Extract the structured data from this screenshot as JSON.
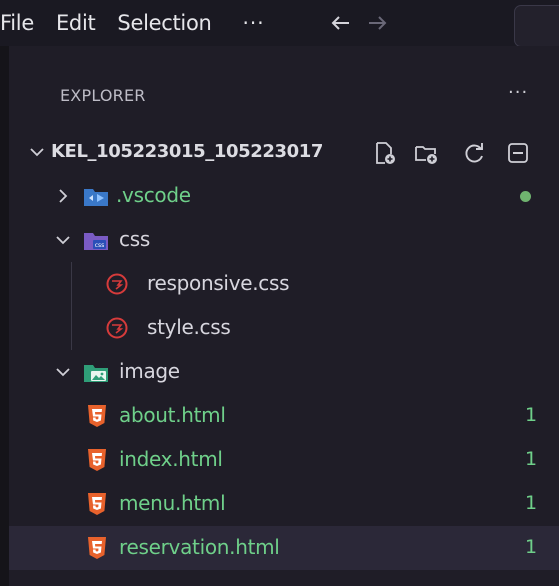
{
  "menubar": {
    "file": "File",
    "edit": "Edit",
    "selection": "Selection",
    "more": "···",
    "back_icon": "arrow-left-icon",
    "forward_icon": "arrow-right-icon"
  },
  "explorer": {
    "title": "EXPLORER",
    "more": "···",
    "root": {
      "label": "KEL_105223015_105223017",
      "actions": [
        "new-file-icon",
        "new-folder-icon",
        "refresh-icon",
        "collapse-all-icon"
      ]
    },
    "items": [
      {
        "label": ".vscode",
        "type": "folder",
        "expanded": false,
        "status": "dot",
        "color": "#6fd08a"
      },
      {
        "label": "css",
        "type": "folder",
        "expanded": true
      },
      {
        "label": "responsive.css",
        "type": "file"
      },
      {
        "label": "style.css",
        "type": "file"
      },
      {
        "label": "image",
        "type": "folder",
        "expanded": true
      },
      {
        "label": "about.html",
        "type": "file",
        "badge": "1"
      },
      {
        "label": "index.html",
        "type": "file",
        "badge": "1"
      },
      {
        "label": "menu.html",
        "type": "file",
        "badge": "1"
      },
      {
        "label": "reservation.html",
        "type": "file",
        "badge": "1",
        "selected": true
      }
    ]
  },
  "colors": {
    "accent_green": "#6fd08a",
    "html_icon": "#e8622c",
    "css_icon": "#d63b3b",
    "selected_row": "#2b2838"
  }
}
